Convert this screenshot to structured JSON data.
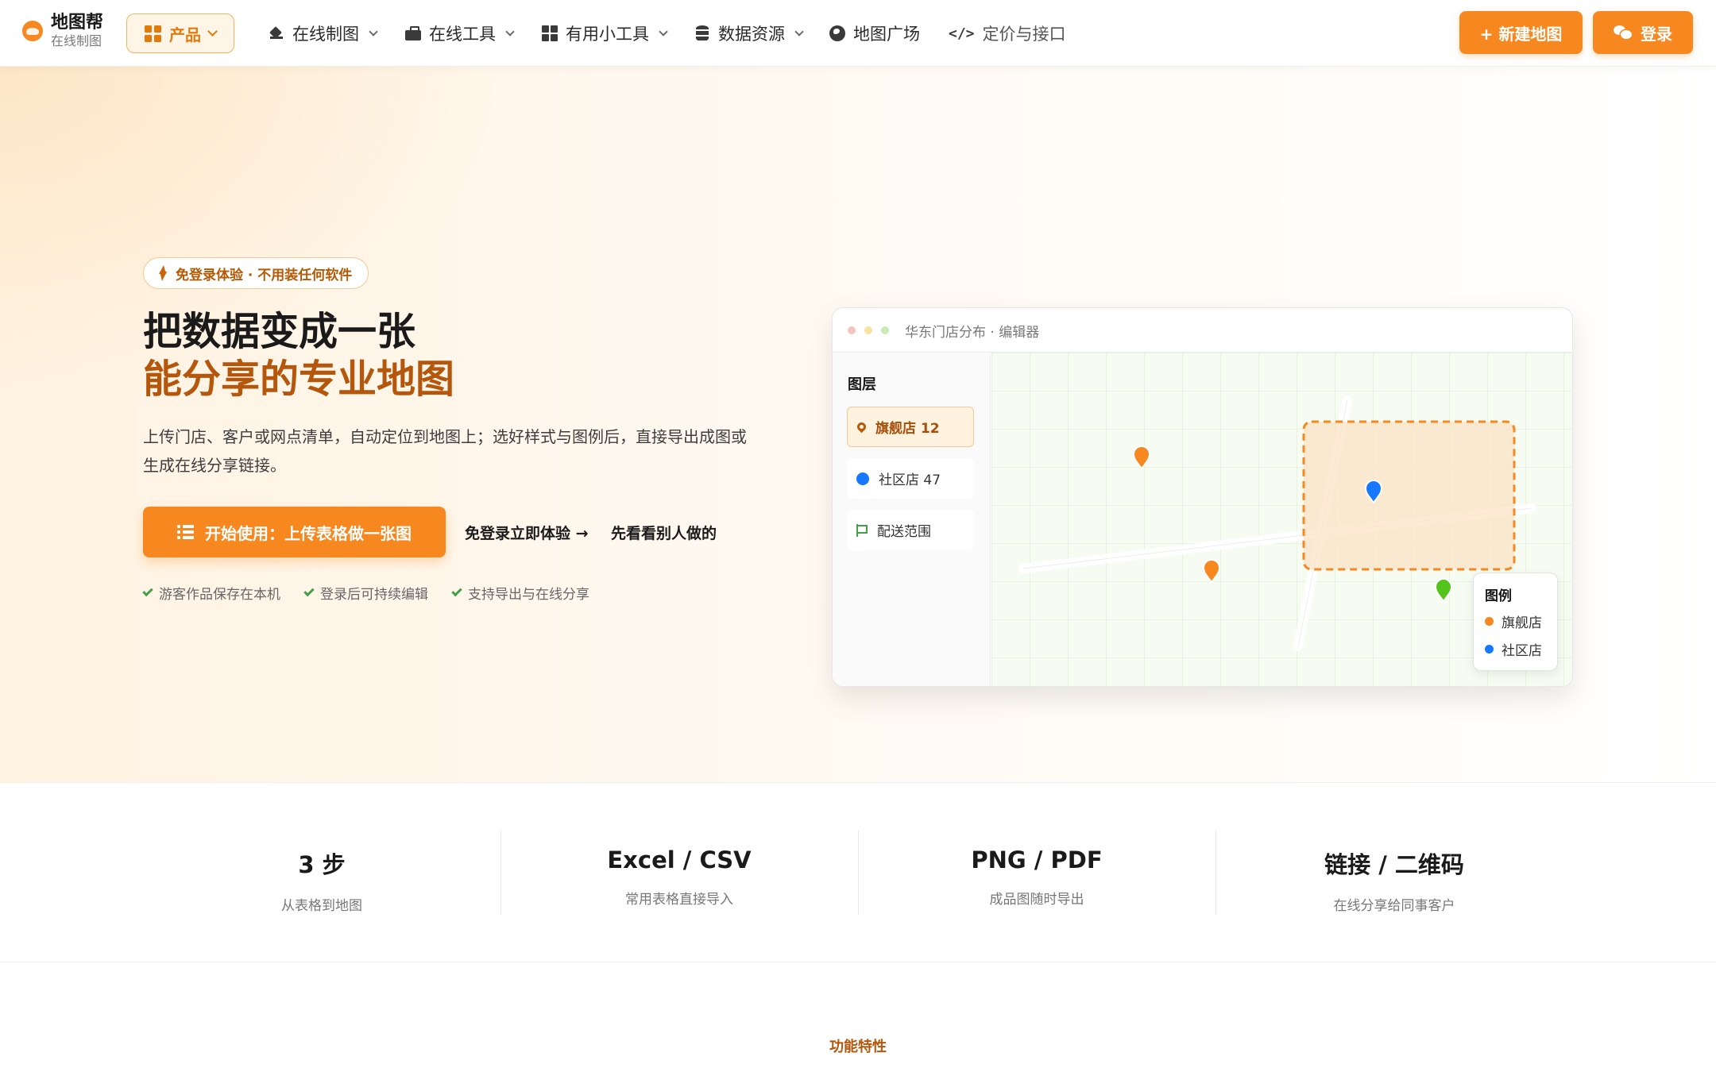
{
  "brand": {
    "name": "地图帮",
    "subtitle": "在线制图"
  },
  "nav": {
    "product": "产品",
    "items": [
      {
        "label": "在线制图"
      },
      {
        "label": "在线工具"
      },
      {
        "label": "有用小工具"
      },
      {
        "label": "数据资源"
      },
      {
        "label": "地图广场"
      },
      {
        "label": "定价与接口"
      }
    ],
    "new_map": "+ 新建地图",
    "login": "登录"
  },
  "hero": {
    "badge": "免登录体验 · 不用装任何软件",
    "title_line1": "把数据变成一张",
    "title_line2": "能分享的专业地图",
    "description": "上传门店、客户或网点清单，自动定位到地图上；选好样式与图例后，直接导出成图或生成在线分享链接。",
    "cta": "开始使用：上传表格做一张图",
    "link_try": "免登录立即体验 →",
    "link_gallery": "先看看别人做的",
    "checks": [
      "游客作品保存在本机",
      "登录后可持续编辑",
      "支持导出与在线分享"
    ]
  },
  "editor": {
    "title": "华东门店分布 · 编辑器",
    "layers_heading": "图层",
    "layers": [
      {
        "label": "旗舰店 12"
      },
      {
        "label": "社区店 47"
      },
      {
        "label": "配送范围"
      }
    ],
    "legend_heading": "图例",
    "legend": [
      {
        "label": "旗舰店",
        "color": "#f7871f"
      },
      {
        "label": "社区店",
        "color": "#1677ff"
      }
    ],
    "colors": {
      "orange": "#f7871f",
      "blue": "#1677ff",
      "green": "#52c41a"
    }
  },
  "stats": [
    {
      "value": "3 步",
      "label": "从表格到地图"
    },
    {
      "value": "Excel / CSV",
      "label": "常用表格直接导入"
    },
    {
      "value": "PNG / PDF",
      "label": "成品图随时导出"
    },
    {
      "value": "链接 / 二维码",
      "label": "在线分享给同事客户"
    }
  ],
  "features_label": "功能特性"
}
